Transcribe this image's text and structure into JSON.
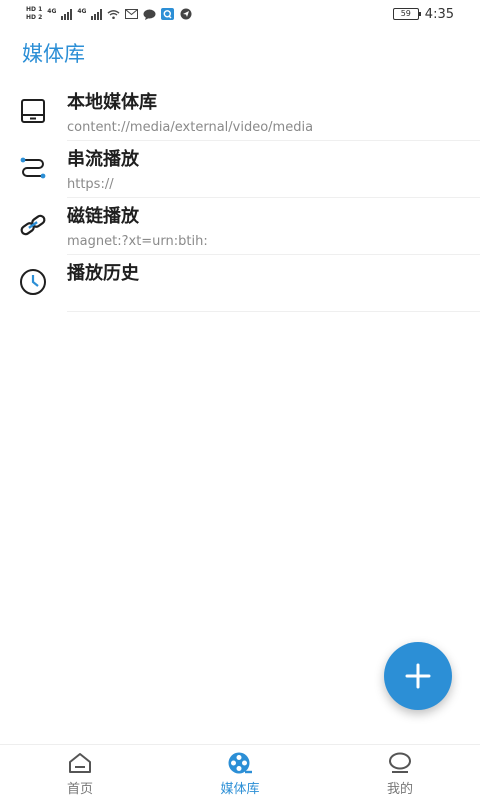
{
  "status_bar": {
    "sim1_label": "HD 1",
    "sim2_label": "HD 2",
    "net1": "4G",
    "net2": "4G",
    "battery": "59",
    "time": "4:35"
  },
  "header": {
    "title": "媒体库"
  },
  "library_items": [
    {
      "title": "本地媒体库",
      "subtitle": "content://media/external/video/media",
      "icon": "tablet-icon"
    },
    {
      "title": "串流播放",
      "subtitle": "https://",
      "icon": "stream-icon"
    },
    {
      "title": "磁链播放",
      "subtitle": "magnet:?xt=urn:btih:",
      "icon": "link-icon"
    },
    {
      "title": "播放历史",
      "subtitle": "",
      "icon": "clock-icon"
    }
  ],
  "fab": {
    "icon": "plus-icon"
  },
  "bottom_nav": {
    "items": [
      {
        "label": "首页",
        "icon": "home-icon",
        "active": false
      },
      {
        "label": "媒体库",
        "icon": "film-reel-icon",
        "active": true
      },
      {
        "label": "我的",
        "icon": "profile-icon",
        "active": false
      }
    ]
  },
  "colors": {
    "accent": "#2c8fd6",
    "title_text": "#1f1f1f",
    "subtitle_text": "#8a8a8a"
  }
}
